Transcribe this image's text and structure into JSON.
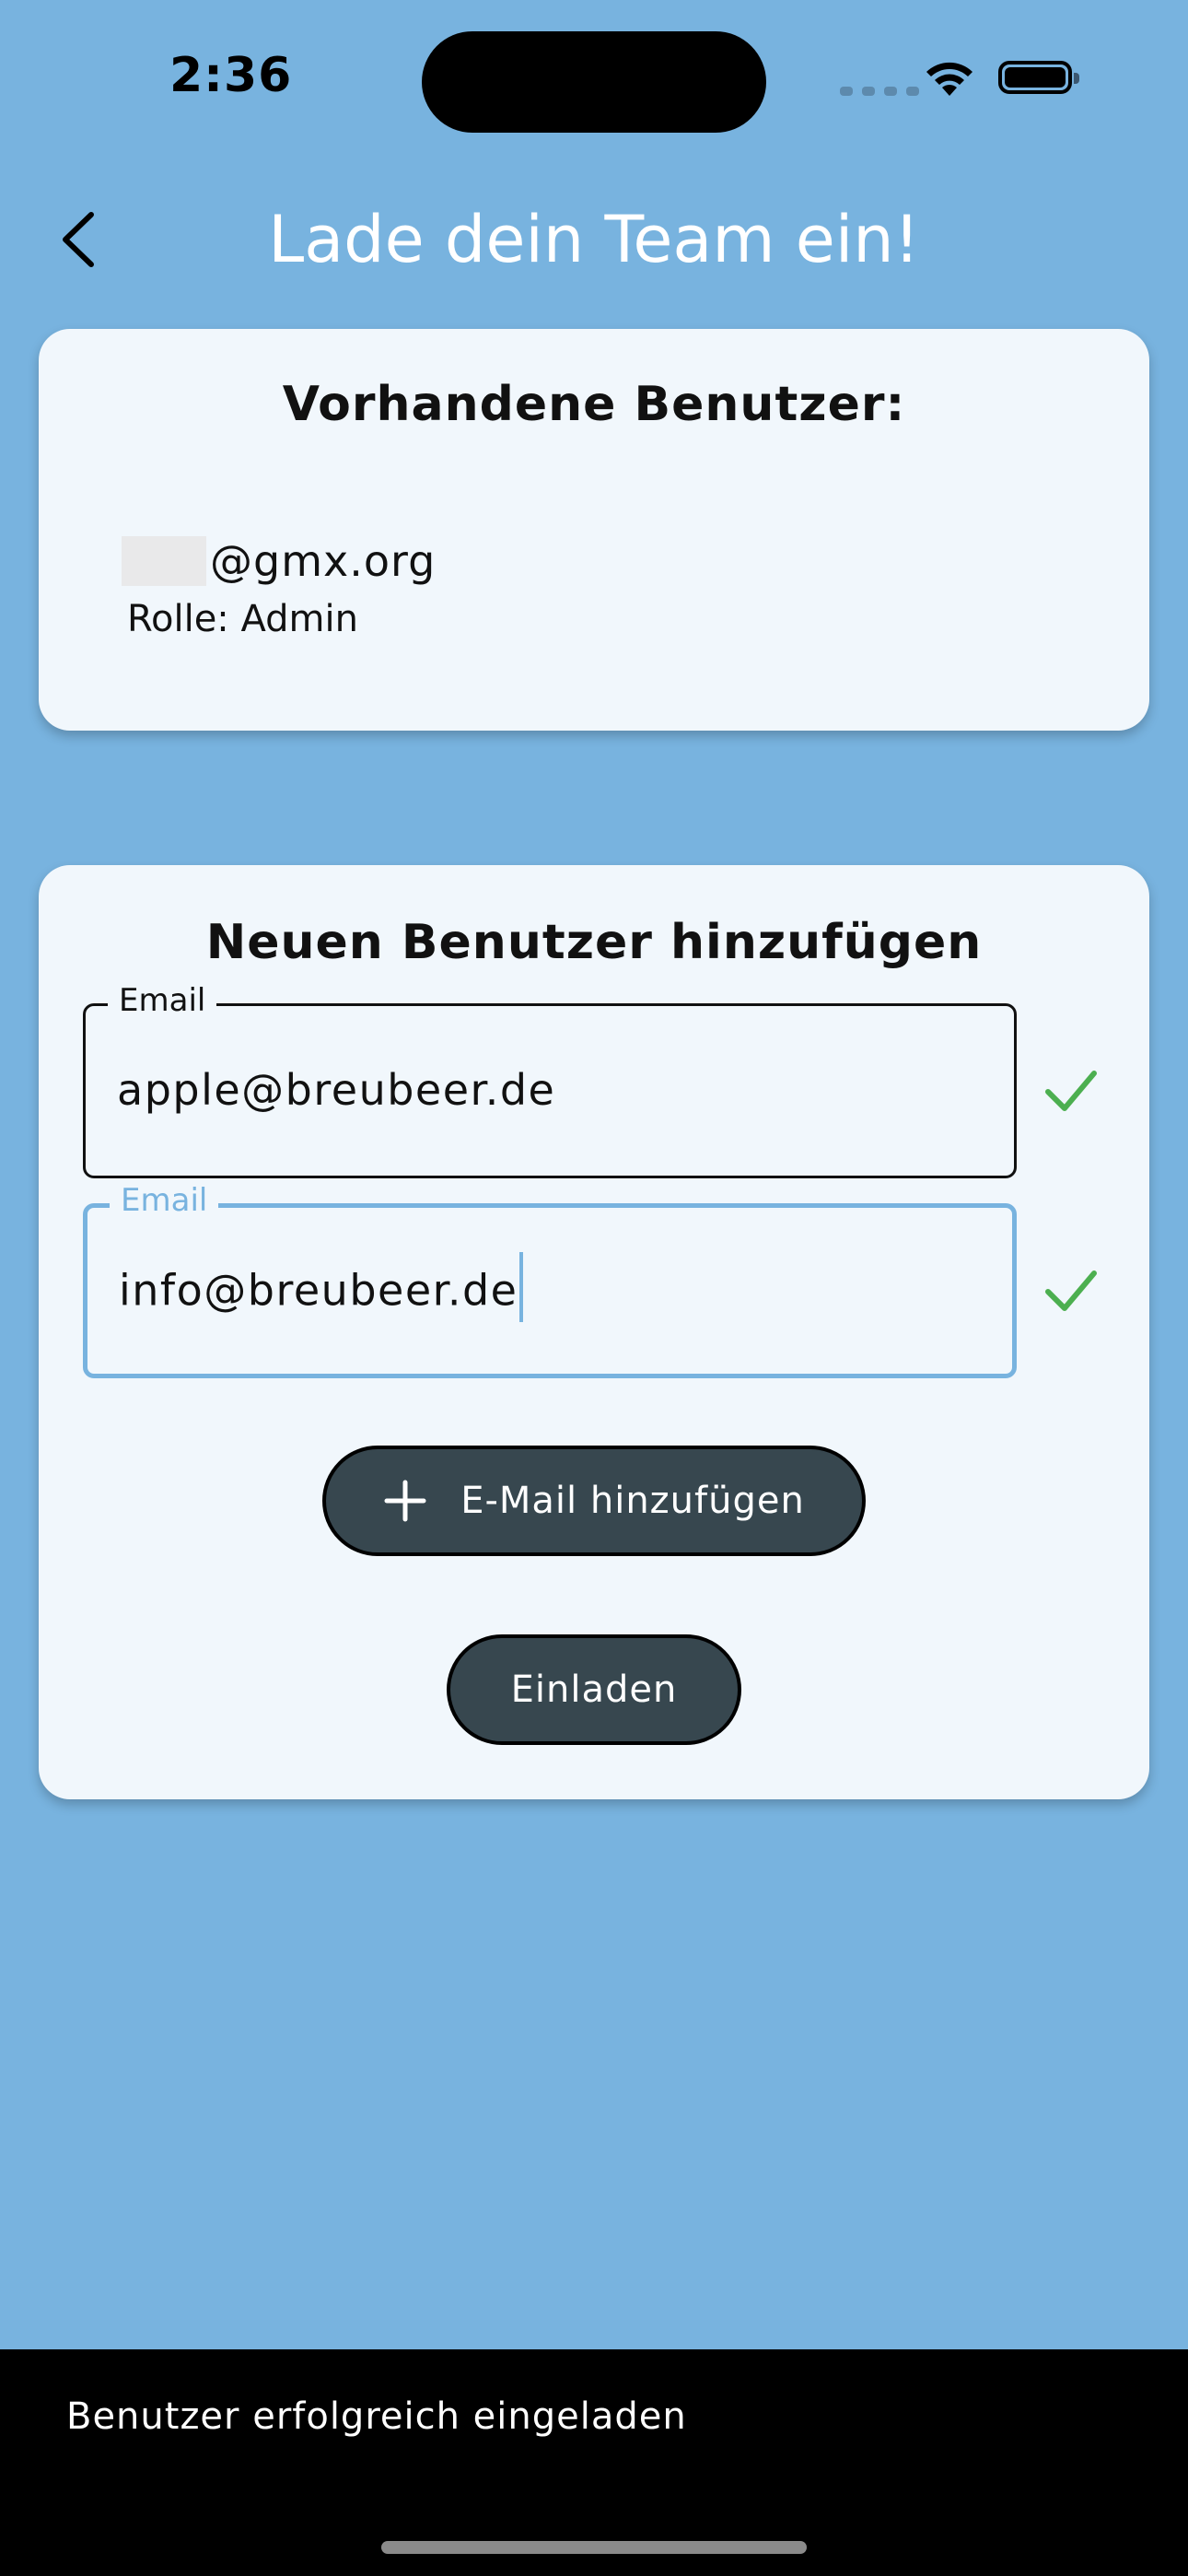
{
  "status_bar": {
    "time": "2:36",
    "icons": [
      "cellular-signal-icon",
      "wifi-icon",
      "battery-icon"
    ]
  },
  "app_bar": {
    "back_icon": "chevron-left-icon",
    "title": "Lade dein Team ein!"
  },
  "existing_users": {
    "heading": "Vorhandene Benutzer:",
    "users": [
      {
        "email": "@gmx.org",
        "role": "Rolle: Admin"
      }
    ]
  },
  "new_user": {
    "heading": "Neuen Benutzer hinzufügen",
    "fields": [
      {
        "label": "Email",
        "value": "apple@breubeer.de",
        "valid": true,
        "focused": false
      },
      {
        "label": "Email",
        "value": "info@breubeer.de",
        "valid": true,
        "focused": true
      }
    ],
    "add_email_button": {
      "icon": "plus-icon",
      "label": "E-Mail hinzufügen"
    },
    "invite_button": {
      "label": "Einladen"
    }
  },
  "snackbar": {
    "message": "Benutzer erfolgreich eingeladen"
  },
  "colors": {
    "background": "#78b3df",
    "card": "#f1f7fc",
    "button": "#37474f",
    "valid_check": "#4caf50",
    "focus_accent": "#78b3df"
  }
}
